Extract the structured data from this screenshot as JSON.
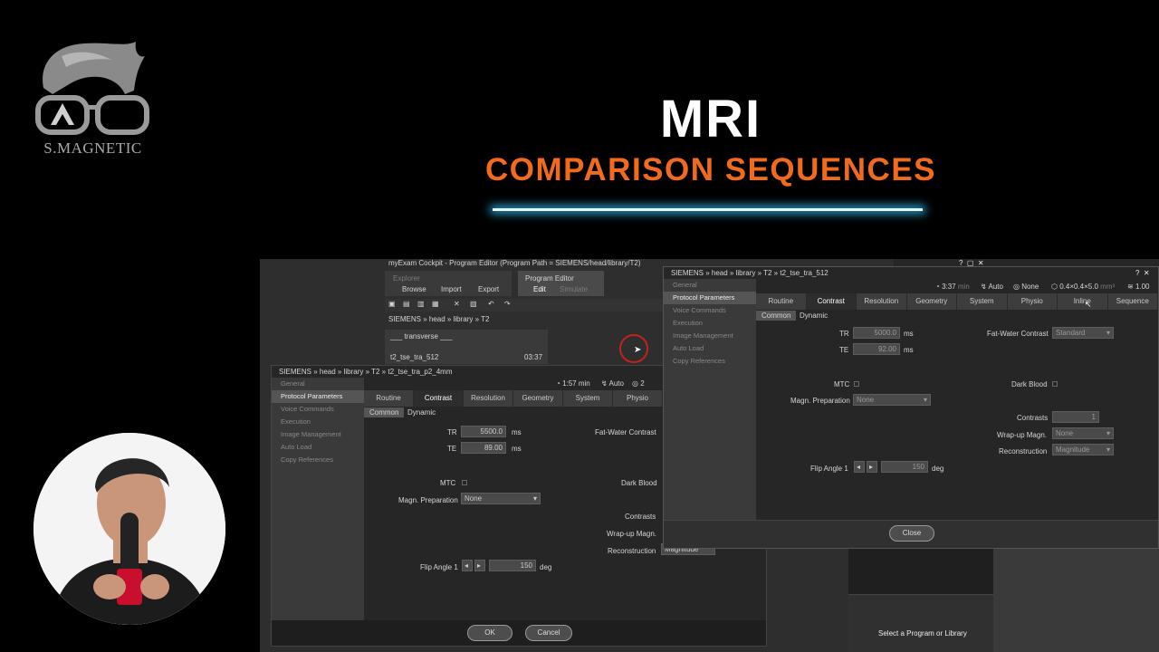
{
  "brand": {
    "logo_text": "S.MAGNETIC"
  },
  "heading": {
    "title": "MRI",
    "subtitle": "COMPARISON SEQUENCES"
  },
  "cockpit": {
    "window_title": "myExam Cockpit - Program Editor (Program Path = SIEMENS/head/library/T2)",
    "explorer_label": "Explorer",
    "explorer_items": [
      "Browse",
      "Import",
      "Export"
    ],
    "editor_label": "Program Editor",
    "editor_items": [
      "Edit",
      "Simulate"
    ],
    "breadcrumb": "SIEMENS » head » library » T2",
    "group_label": "___ transverse ___",
    "list_item": {
      "name": "t2_tse_tra_512",
      "time": "03:37"
    },
    "select_hint": "Select a Program or Library"
  },
  "dialog_back": {
    "breadcrumb": "SIEMENS » head » library » T2 » t2_tse_tra_p2_4mm",
    "status": {
      "time": "1:57 min",
      "auto": "Auto",
      "count": "2"
    },
    "sidebar": [
      "General",
      "Protocol Parameters",
      "Voice Commands",
      "Execution",
      "Image Management",
      "Auto Load",
      "Copy References"
    ],
    "tabs": [
      "Routine",
      "Contrast",
      "Resolution",
      "Geometry",
      "System",
      "Physio"
    ],
    "subtabs": [
      "Common",
      "Dynamic"
    ],
    "tr": {
      "label": "TR",
      "value": "5500.0",
      "unit": "ms"
    },
    "te": {
      "label": "TE",
      "value": "89.00",
      "unit": "ms"
    },
    "fat_water": {
      "label": "Fat-Water Contrast"
    },
    "mtc": {
      "label": "MTC"
    },
    "dark_blood": {
      "label": "Dark Blood"
    },
    "magn_prep": {
      "label": "Magn. Preparation",
      "value": "None"
    },
    "contrasts": {
      "label": "Contrasts"
    },
    "wrap": {
      "label": "Wrap-up Magn."
    },
    "recon": {
      "label": "Reconstruction",
      "value": "Magnitude"
    },
    "flip": {
      "label": "Flip Angle 1",
      "value": "150",
      "unit": "deg"
    },
    "ok": "OK",
    "cancel": "Cancel"
  },
  "dialog_front": {
    "breadcrumb": "SIEMENS » head » library » T2 » t2_tse_tra_512",
    "status": {
      "time": "3:37",
      "time_unit": "min",
      "auto": "Auto",
      "none": "None",
      "voxel": "0.4×0.4×5.0",
      "voxel_unit": "mm³",
      "snr": "1.00"
    },
    "sidebar": [
      "General",
      "Protocol Parameters",
      "Voice Commands",
      "Execution",
      "Image Management",
      "Auto Load",
      "Copy References"
    ],
    "tabs": [
      "Routine",
      "Contrast",
      "Resolution",
      "Geometry",
      "System",
      "Physio",
      "Inline",
      "Sequence"
    ],
    "subtabs": [
      "Common",
      "Dynamic"
    ],
    "tr": {
      "label": "TR",
      "value": "5000.0",
      "unit": "ms"
    },
    "te": {
      "label": "TE",
      "value": "92.00",
      "unit": "ms"
    },
    "fat_water": {
      "label": "Fat-Water Contrast",
      "value": "Standard"
    },
    "mtc": {
      "label": "MTC"
    },
    "dark_blood": {
      "label": "Dark Blood"
    },
    "magn_prep": {
      "label": "Magn. Preparation",
      "value": "None"
    },
    "contrasts": {
      "label": "Contrasts",
      "value": "1"
    },
    "wrap": {
      "label": "Wrap-up Magn.",
      "value": "None"
    },
    "recon": {
      "label": "Reconstruction",
      "value": "Magnitude"
    },
    "flip": {
      "label": "Flip Angle 1",
      "value": "150",
      "unit": "deg"
    },
    "close": "Close"
  },
  "colors": {
    "accent_orange": "#f26b1d",
    "glow_blue": "#2aa7d8"
  }
}
